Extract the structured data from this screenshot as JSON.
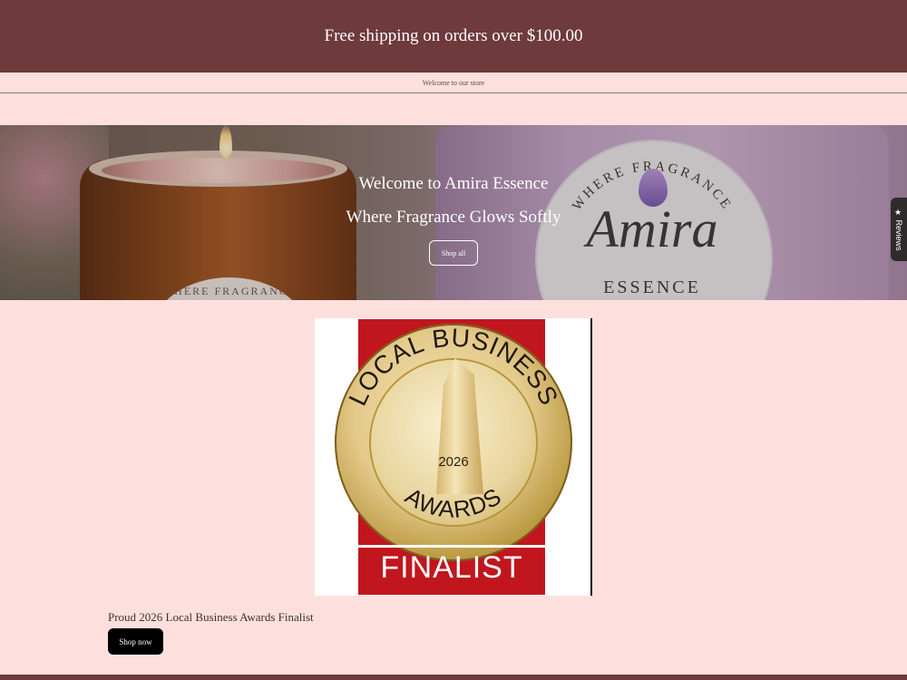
{
  "announcement": {
    "text": "Free shipping on orders over $100.00"
  },
  "header": {
    "welcome_text": "Welcome to our store"
  },
  "hero": {
    "title": "Welcome to Amira Essence",
    "subtitle": "Where Fragrance Glows Softly",
    "button_label": "Shop all",
    "badge_arc_text": "WHERE FRAGRANCE",
    "badge_brand": "Amira",
    "badge_essence": "ESSENCE",
    "jar_label_text": "WHERE FRAGRANCE"
  },
  "award": {
    "arc_text": "LOCAL BUSINESS",
    "bottom_arc_text": "AWARDS",
    "year": "2026",
    "finalist": "FINALIST",
    "caption": "Proud 2026 Local Business Awards Finalist",
    "button_label": "Shop now"
  },
  "reviews_tab": {
    "label": "★ Reviews"
  },
  "colors": {
    "announcement_bg": "#6e3a3c",
    "page_bg": "#fde0de",
    "award_red": "#c1161e"
  }
}
